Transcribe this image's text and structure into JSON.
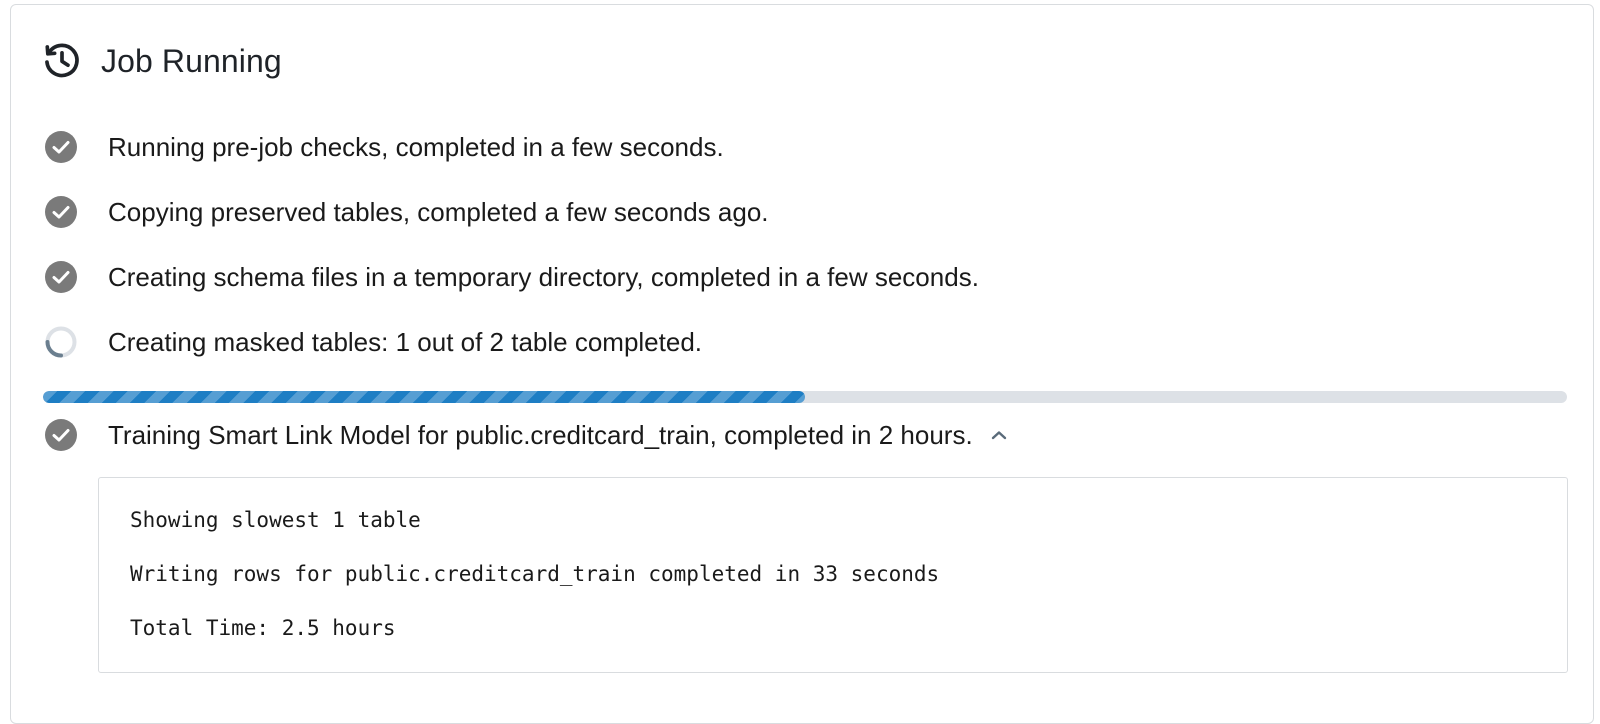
{
  "header": {
    "title": "Job Running",
    "icon": "history-icon"
  },
  "steps": [
    {
      "label": "Running pre-job checks, completed in a few seconds.",
      "status": "completed",
      "icon": "check-circle-icon"
    },
    {
      "label": "Copying preserved tables, completed a few seconds ago.",
      "status": "completed",
      "icon": "check-circle-icon"
    },
    {
      "label": "Creating schema files in a temporary directory, completed in a few seconds.",
      "status": "completed",
      "icon": "check-circle-icon"
    },
    {
      "label": "Creating masked tables: 1 out of 2 table completed.",
      "status": "in-progress",
      "icon": "spinner-icon"
    },
    {
      "label": "Training Smart Link Model for public.creditcard_train, completed in 2 hours.",
      "status": "completed",
      "icon": "check-circle-icon",
      "expanded": true
    }
  ],
  "progress": {
    "fraction": 0.5,
    "color": "#1e7ec4"
  },
  "details": {
    "lines": [
      "Showing slowest 1 table",
      "Writing rows for public.creditcard_train completed in 33 seconds",
      "Total Time: 2.5 hours"
    ]
  },
  "colors": {
    "check": "#7a7a7a",
    "spinner_track": "#dde1e6",
    "spinner_arc": "#6b7f8f",
    "chevron": "#5a6b7a"
  }
}
